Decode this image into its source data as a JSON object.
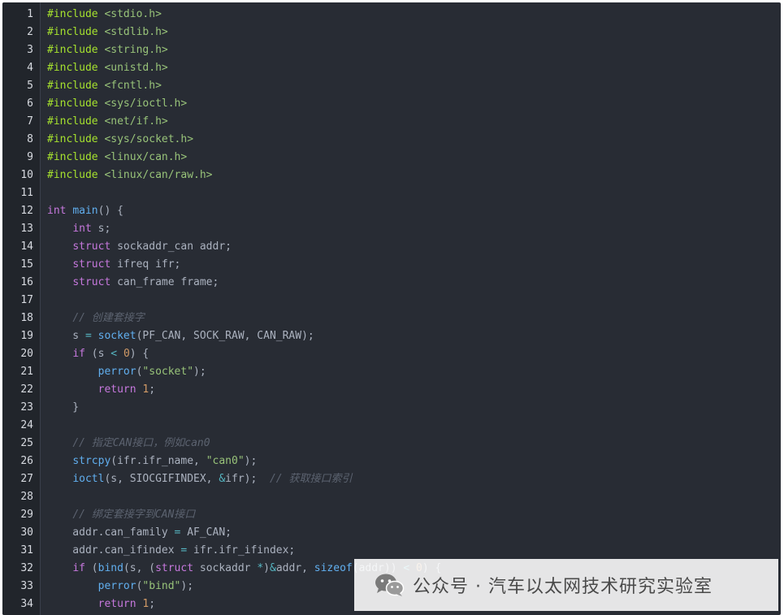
{
  "editor": {
    "language": "c",
    "lines": [
      {
        "n": "1",
        "tokens": [
          [
            "inc",
            "#include"
          ],
          [
            "pl",
            " "
          ],
          [
            "hdr",
            "<stdio.h>"
          ]
        ]
      },
      {
        "n": "2",
        "tokens": [
          [
            "inc",
            "#include"
          ],
          [
            "pl",
            " "
          ],
          [
            "hdr",
            "<stdlib.h>"
          ]
        ]
      },
      {
        "n": "3",
        "tokens": [
          [
            "inc",
            "#include"
          ],
          [
            "pl",
            " "
          ],
          [
            "hdr",
            "<string.h>"
          ]
        ]
      },
      {
        "n": "4",
        "tokens": [
          [
            "inc",
            "#include"
          ],
          [
            "pl",
            " "
          ],
          [
            "hdr",
            "<unistd.h>"
          ]
        ]
      },
      {
        "n": "5",
        "tokens": [
          [
            "inc",
            "#include"
          ],
          [
            "pl",
            " "
          ],
          [
            "hdr",
            "<fcntl.h>"
          ]
        ]
      },
      {
        "n": "6",
        "tokens": [
          [
            "inc",
            "#include"
          ],
          [
            "pl",
            " "
          ],
          [
            "hdr",
            "<sys/ioctl.h>"
          ]
        ]
      },
      {
        "n": "7",
        "tokens": [
          [
            "inc",
            "#include"
          ],
          [
            "pl",
            " "
          ],
          [
            "hdr",
            "<net/if.h>"
          ]
        ]
      },
      {
        "n": "8",
        "tokens": [
          [
            "inc",
            "#include"
          ],
          [
            "pl",
            " "
          ],
          [
            "hdr",
            "<sys/socket.h>"
          ]
        ]
      },
      {
        "n": "9",
        "tokens": [
          [
            "inc",
            "#include"
          ],
          [
            "pl",
            " "
          ],
          [
            "hdr",
            "<linux/can.h>"
          ]
        ]
      },
      {
        "n": "10",
        "tokens": [
          [
            "inc",
            "#include"
          ],
          [
            "pl",
            " "
          ],
          [
            "hdr",
            "<linux/can/raw.h>"
          ]
        ]
      },
      {
        "n": "11",
        "tokens": []
      },
      {
        "n": "12",
        "tokens": [
          [
            "kw",
            "int"
          ],
          [
            "pl",
            " "
          ],
          [
            "fn",
            "main"
          ],
          [
            "pl",
            "() {"
          ]
        ]
      },
      {
        "n": "13",
        "tokens": [
          [
            "pl",
            "    "
          ],
          [
            "kw",
            "int"
          ],
          [
            "pl",
            " s;"
          ]
        ]
      },
      {
        "n": "14",
        "tokens": [
          [
            "pl",
            "    "
          ],
          [
            "kw",
            "struct"
          ],
          [
            "pl",
            " sockaddr_can addr;"
          ]
        ]
      },
      {
        "n": "15",
        "tokens": [
          [
            "pl",
            "    "
          ],
          [
            "kw",
            "struct"
          ],
          [
            "pl",
            " ifreq ifr;"
          ]
        ]
      },
      {
        "n": "16",
        "tokens": [
          [
            "pl",
            "    "
          ],
          [
            "kw",
            "struct"
          ],
          [
            "pl",
            " can_frame frame;"
          ]
        ]
      },
      {
        "n": "17",
        "tokens": []
      },
      {
        "n": "18",
        "tokens": [
          [
            "pl",
            "    "
          ],
          [
            "cm",
            "// 创建套接字"
          ]
        ]
      },
      {
        "n": "19",
        "tokens": [
          [
            "pl",
            "    s "
          ],
          [
            "op",
            "="
          ],
          [
            "pl",
            " "
          ],
          [
            "fn",
            "socket"
          ],
          [
            "pl",
            "(PF_CAN, SOCK_RAW, CAN_RAW);"
          ]
        ]
      },
      {
        "n": "20",
        "tokens": [
          [
            "pl",
            "    "
          ],
          [
            "kw",
            "if"
          ],
          [
            "pl",
            " (s "
          ],
          [
            "op",
            "<"
          ],
          [
            "pl",
            " "
          ],
          [
            "num",
            "0"
          ],
          [
            "pl",
            ") {"
          ]
        ]
      },
      {
        "n": "21",
        "tokens": [
          [
            "pl",
            "        "
          ],
          [
            "fn",
            "perror"
          ],
          [
            "pl",
            "("
          ],
          [
            "str",
            "\"socket\""
          ],
          [
            "pl",
            ");"
          ]
        ]
      },
      {
        "n": "22",
        "tokens": [
          [
            "pl",
            "        "
          ],
          [
            "kw",
            "return"
          ],
          [
            "pl",
            " "
          ],
          [
            "num",
            "1"
          ],
          [
            "pl",
            ";"
          ]
        ]
      },
      {
        "n": "23",
        "tokens": [
          [
            "pl",
            "    }"
          ]
        ]
      },
      {
        "n": "24",
        "tokens": []
      },
      {
        "n": "25",
        "tokens": [
          [
            "pl",
            "    "
          ],
          [
            "cm",
            "// 指定CAN接口，例如can0"
          ]
        ]
      },
      {
        "n": "26",
        "tokens": [
          [
            "pl",
            "    "
          ],
          [
            "fn",
            "strcpy"
          ],
          [
            "pl",
            "(ifr.ifr_name, "
          ],
          [
            "str",
            "\"can0\""
          ],
          [
            "pl",
            ");"
          ]
        ]
      },
      {
        "n": "27",
        "tokens": [
          [
            "pl",
            "    "
          ],
          [
            "fn",
            "ioctl"
          ],
          [
            "pl",
            "(s, SIOCGIFINDEX, "
          ],
          [
            "op",
            "&"
          ],
          [
            "pl",
            "ifr);  "
          ],
          [
            "cm",
            "// 获取接口索引"
          ]
        ]
      },
      {
        "n": "28",
        "tokens": []
      },
      {
        "n": "29",
        "tokens": [
          [
            "pl",
            "    "
          ],
          [
            "cm",
            "// 绑定套接字到CAN接口"
          ]
        ]
      },
      {
        "n": "30",
        "tokens": [
          [
            "pl",
            "    addr.can_family "
          ],
          [
            "op",
            "="
          ],
          [
            "pl",
            " AF_CAN;"
          ]
        ]
      },
      {
        "n": "31",
        "tokens": [
          [
            "pl",
            "    addr.can_ifindex "
          ],
          [
            "op",
            "="
          ],
          [
            "pl",
            " ifr.ifr_ifindex;"
          ]
        ]
      },
      {
        "n": "32",
        "tokens": [
          [
            "pl",
            "    "
          ],
          [
            "kw",
            "if"
          ],
          [
            "pl",
            " ("
          ],
          [
            "fn",
            "bind"
          ],
          [
            "pl",
            "(s, ("
          ],
          [
            "kw",
            "struct"
          ],
          [
            "pl",
            " sockaddr "
          ],
          [
            "op",
            "*"
          ],
          [
            "pl",
            ")"
          ],
          [
            "op",
            "&"
          ],
          [
            "pl",
            "addr, "
          ],
          [
            "fn",
            "sizeof"
          ],
          [
            "pl",
            "(addr)) "
          ],
          [
            "op",
            "<"
          ],
          [
            "pl",
            " "
          ],
          [
            "num",
            "0"
          ],
          [
            "pl",
            ") {"
          ]
        ]
      },
      {
        "n": "33",
        "tokens": [
          [
            "pl",
            "        "
          ],
          [
            "fn",
            "perror"
          ],
          [
            "pl",
            "("
          ],
          [
            "str",
            "\"bind\""
          ],
          [
            "pl",
            ");"
          ]
        ]
      },
      {
        "n": "34",
        "tokens": [
          [
            "pl",
            "        "
          ],
          [
            "kw",
            "return"
          ],
          [
            "pl",
            " "
          ],
          [
            "num",
            "1"
          ],
          [
            "pl",
            ";"
          ]
        ]
      }
    ]
  },
  "watermark": {
    "text": "公众号 · 汽车以太网技术研究实验室",
    "icon": "wechat-icon"
  },
  "colors": {
    "background": "#282c34",
    "gutter": "#21252b",
    "keyword": "#c678dd",
    "function": "#61afef",
    "string": "#98c379",
    "number": "#d19a66",
    "comment": "#5c6370"
  }
}
